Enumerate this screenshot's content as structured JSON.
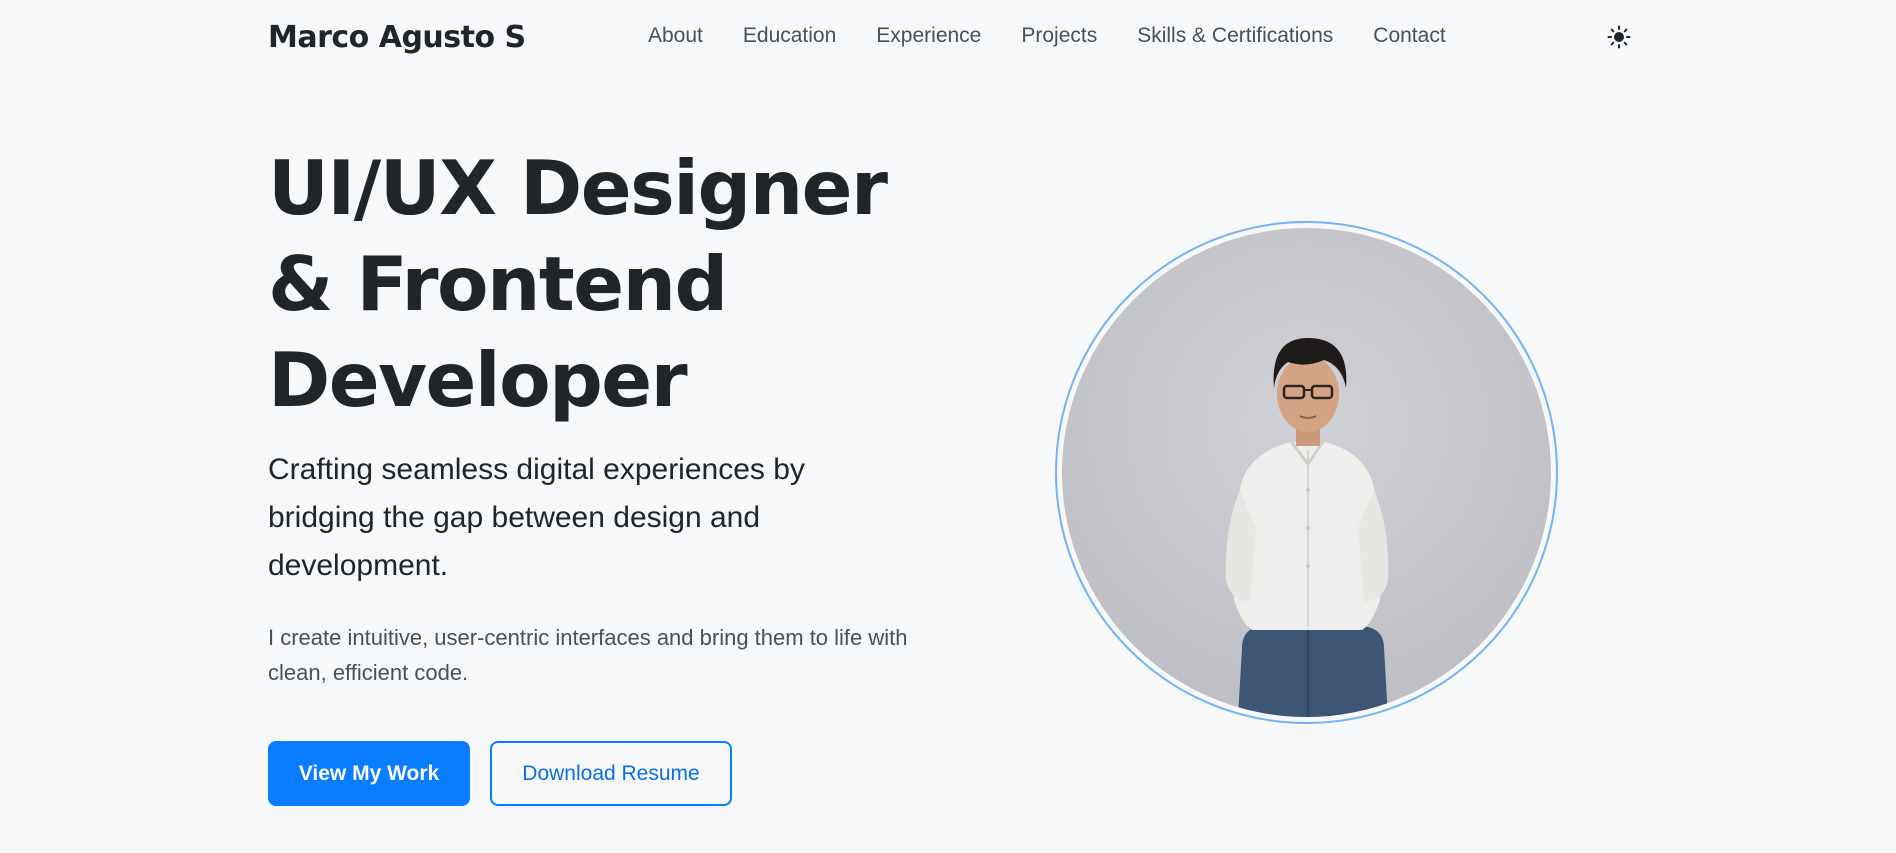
{
  "header": {
    "brand": "Marco Agusto S",
    "nav": [
      "About",
      "Education",
      "Experience",
      "Projects",
      "Skills & Certifications",
      "Contact"
    ],
    "theme_icon": "sun-icon"
  },
  "hero": {
    "headline_lines": [
      "UI/UX Designer",
      "& Frontend",
      "Developer"
    ],
    "tagline": "Crafting seamless digital experiences by bridging the gap between design and development.",
    "lead": "I create intuitive, user-centric interfaces and bring them to life with clean, efficient code.",
    "primary_button": "View My Work",
    "secondary_button": "Download Resume"
  },
  "colors": {
    "background": "#f7f8fa",
    "accent": "#0a7cff",
    "ring": "#74b3f5",
    "text": "#212529",
    "muted": "#495057"
  }
}
